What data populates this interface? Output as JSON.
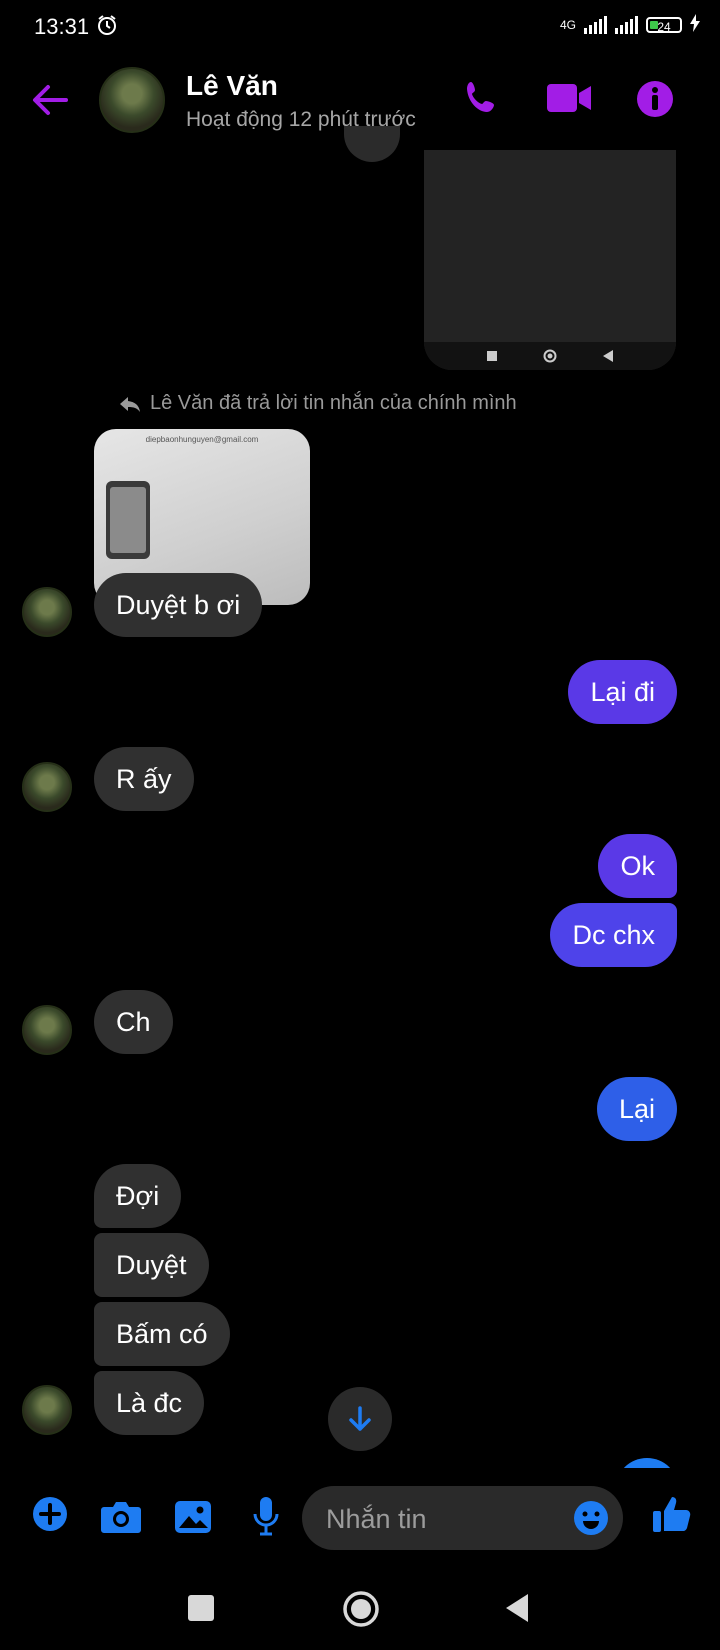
{
  "status_bar": {
    "time": "13:31",
    "network": "4G",
    "battery": "24"
  },
  "header": {
    "contact_name": "Lê Văn",
    "contact_status": "Hoạt động 12 phút trước"
  },
  "reply_note": "Lê Văn đã trả lời tin nhắn của chính mình",
  "reply_image_email": "diepbaonhunguyen@gmail.com",
  "messages": {
    "m1": "Duyệt b ơi",
    "m2": "Lại đi",
    "m3": "R ấy",
    "m4": "Ok",
    "m5": "Dc chx",
    "m6": "Ch",
    "m7": "Lại",
    "m8": "Đợi",
    "m9": "Duyệt",
    "m10": "Bấm có",
    "m11": "Là đc"
  },
  "composer": {
    "placeholder": "Nhắn tin"
  },
  "colors": {
    "accent_purple": "#a21de6",
    "outgoing_purple": "#5a39e7",
    "outgoing_blue": "#2e5fe8",
    "incoming": "#303030",
    "icon_blue": "#1e7cf2"
  }
}
